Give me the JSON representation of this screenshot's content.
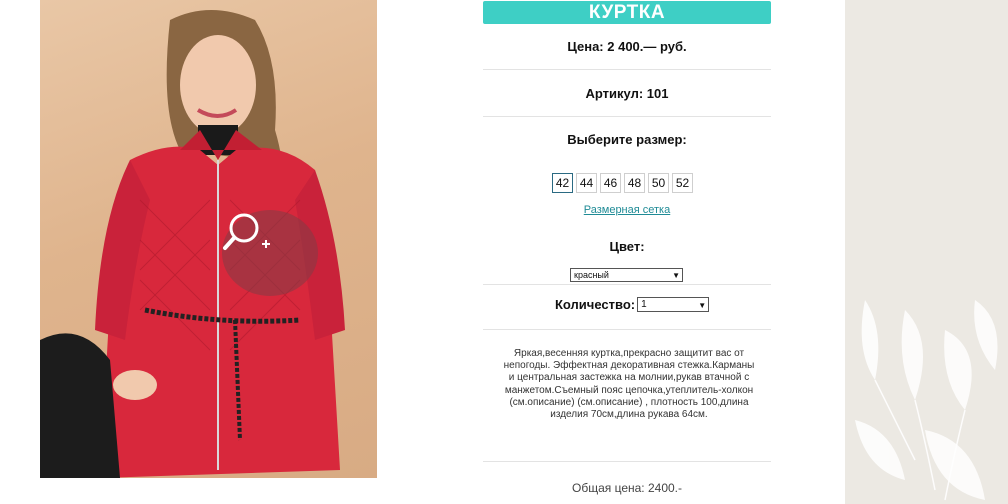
{
  "product": {
    "title": "КУРТКА",
    "price_line": "Цена: 2 400.— руб.",
    "article_line": "Артикул: 101",
    "choose_size_label": "Выберите размер:",
    "sizes": [
      "42",
      "44",
      "46",
      "48",
      "50",
      "52"
    ],
    "selected_size": "42",
    "size_chart_link": "Размерная сетка",
    "color_label": "Цвет:",
    "color_selected": "красный",
    "quantity_label": "Количество:",
    "quantity_selected": "1",
    "description": "Яркая,весенняя куртка,прекрасно защитит вас от непогоды. Эффектная декоративная стежка.Карманы и центральная застежка на молнии,рукав втачной с манжетом.Съемный пояс цепочка,утеплитель-холкон (см.описание) (см.описание) , плотность 100,длина изделия 70см,длина рукава 64см.",
    "total_line": "Общая цена: 2400.-"
  },
  "colors": {
    "accent": "#3ecfc5",
    "link": "#1f8b96",
    "jacket": "#d8283c"
  },
  "icons": {
    "zoom": "zoom-in-icon",
    "dropdown": "chevron-down-icon"
  }
}
